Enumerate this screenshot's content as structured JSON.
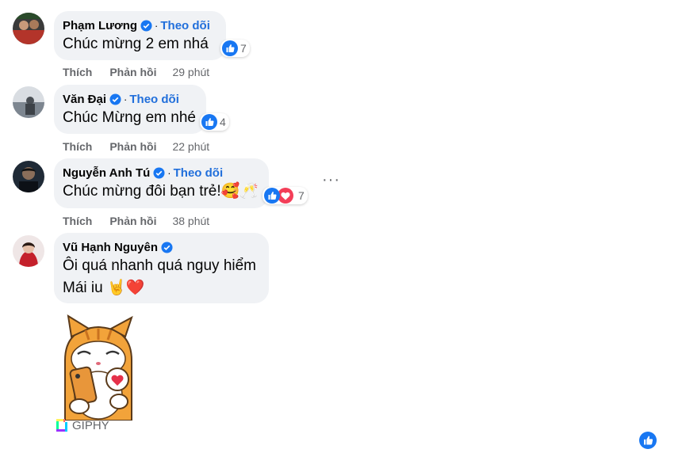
{
  "comments": [
    {
      "name": "Phạm Lương",
      "follow": "Theo dõi",
      "dot": "·",
      "text": "Chúc mừng 2 em nhá",
      "reaction_count": "7",
      "like": "Thích",
      "reply": "Phản hồi",
      "time": "29 phút"
    },
    {
      "name": "Văn Đại",
      "follow": "Theo dõi",
      "dot": "·",
      "text": "Chúc Mừng em nhé",
      "reaction_count": "4",
      "like": "Thích",
      "reply": "Phản hồi",
      "time": "22 phút"
    },
    {
      "name": "Nguyễn Anh Tú",
      "follow": "Theo dõi",
      "dot": "·",
      "text": "Chúc mừng đôi bạn trẻ!🥰🥂",
      "reaction_count": "7",
      "like": "Thích",
      "reply": "Phản hồi",
      "time": "38 phút"
    },
    {
      "name": "Vũ Hạnh Nguyên",
      "line1": "Ôi quá nhanh quá nguy hiểm",
      "line2": "Mái iu 🤘❤️"
    }
  ],
  "giphy_label": "GIPHY",
  "more_label": "···",
  "colors": {
    "bubble": "#f0f2f5",
    "follow": "#216fdb",
    "like_blue": "#1877f2",
    "love_red": "#f33e58",
    "meta_gray": "#65676b"
  },
  "icons": {
    "verified": "verified-badge-icon",
    "like": "thumbs-up-icon",
    "love": "heart-icon",
    "more": "more-options-icon",
    "giphy": "giphy-logo-icon"
  }
}
